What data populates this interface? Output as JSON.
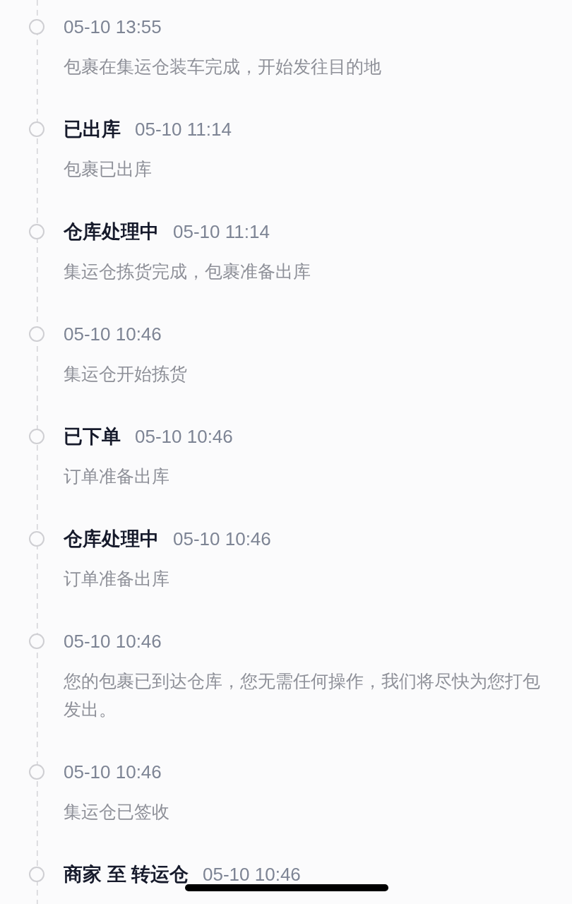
{
  "timeline": [
    {
      "time": "05-10 13:55",
      "description": "包裹在集运仓装车完成，开始发往目的地"
    },
    {
      "status": "已出库",
      "time": "05-10 11:14",
      "description": "包裹已出库"
    },
    {
      "status": "仓库处理中",
      "time": "05-10 11:14",
      "description": "集运仓拣货完成，包裹准备出库"
    },
    {
      "time": "05-10 10:46",
      "description": "集运仓开始拣货"
    },
    {
      "status": "已下单",
      "time": "05-10 10:46",
      "description": "订单准备出库"
    },
    {
      "status": "仓库处理中",
      "time": "05-10 10:46",
      "description": "订单准备出库"
    },
    {
      "time": "05-10 10:46",
      "description": "您的包裹已到达仓库，您无需任何操作，我们将尽快为您打包发出。"
    },
    {
      "time": "05-10 10:46",
      "description": "集运仓已签收"
    },
    {
      "status": "商家 至 转运仓",
      "time": "05-10 10:46"
    }
  ]
}
